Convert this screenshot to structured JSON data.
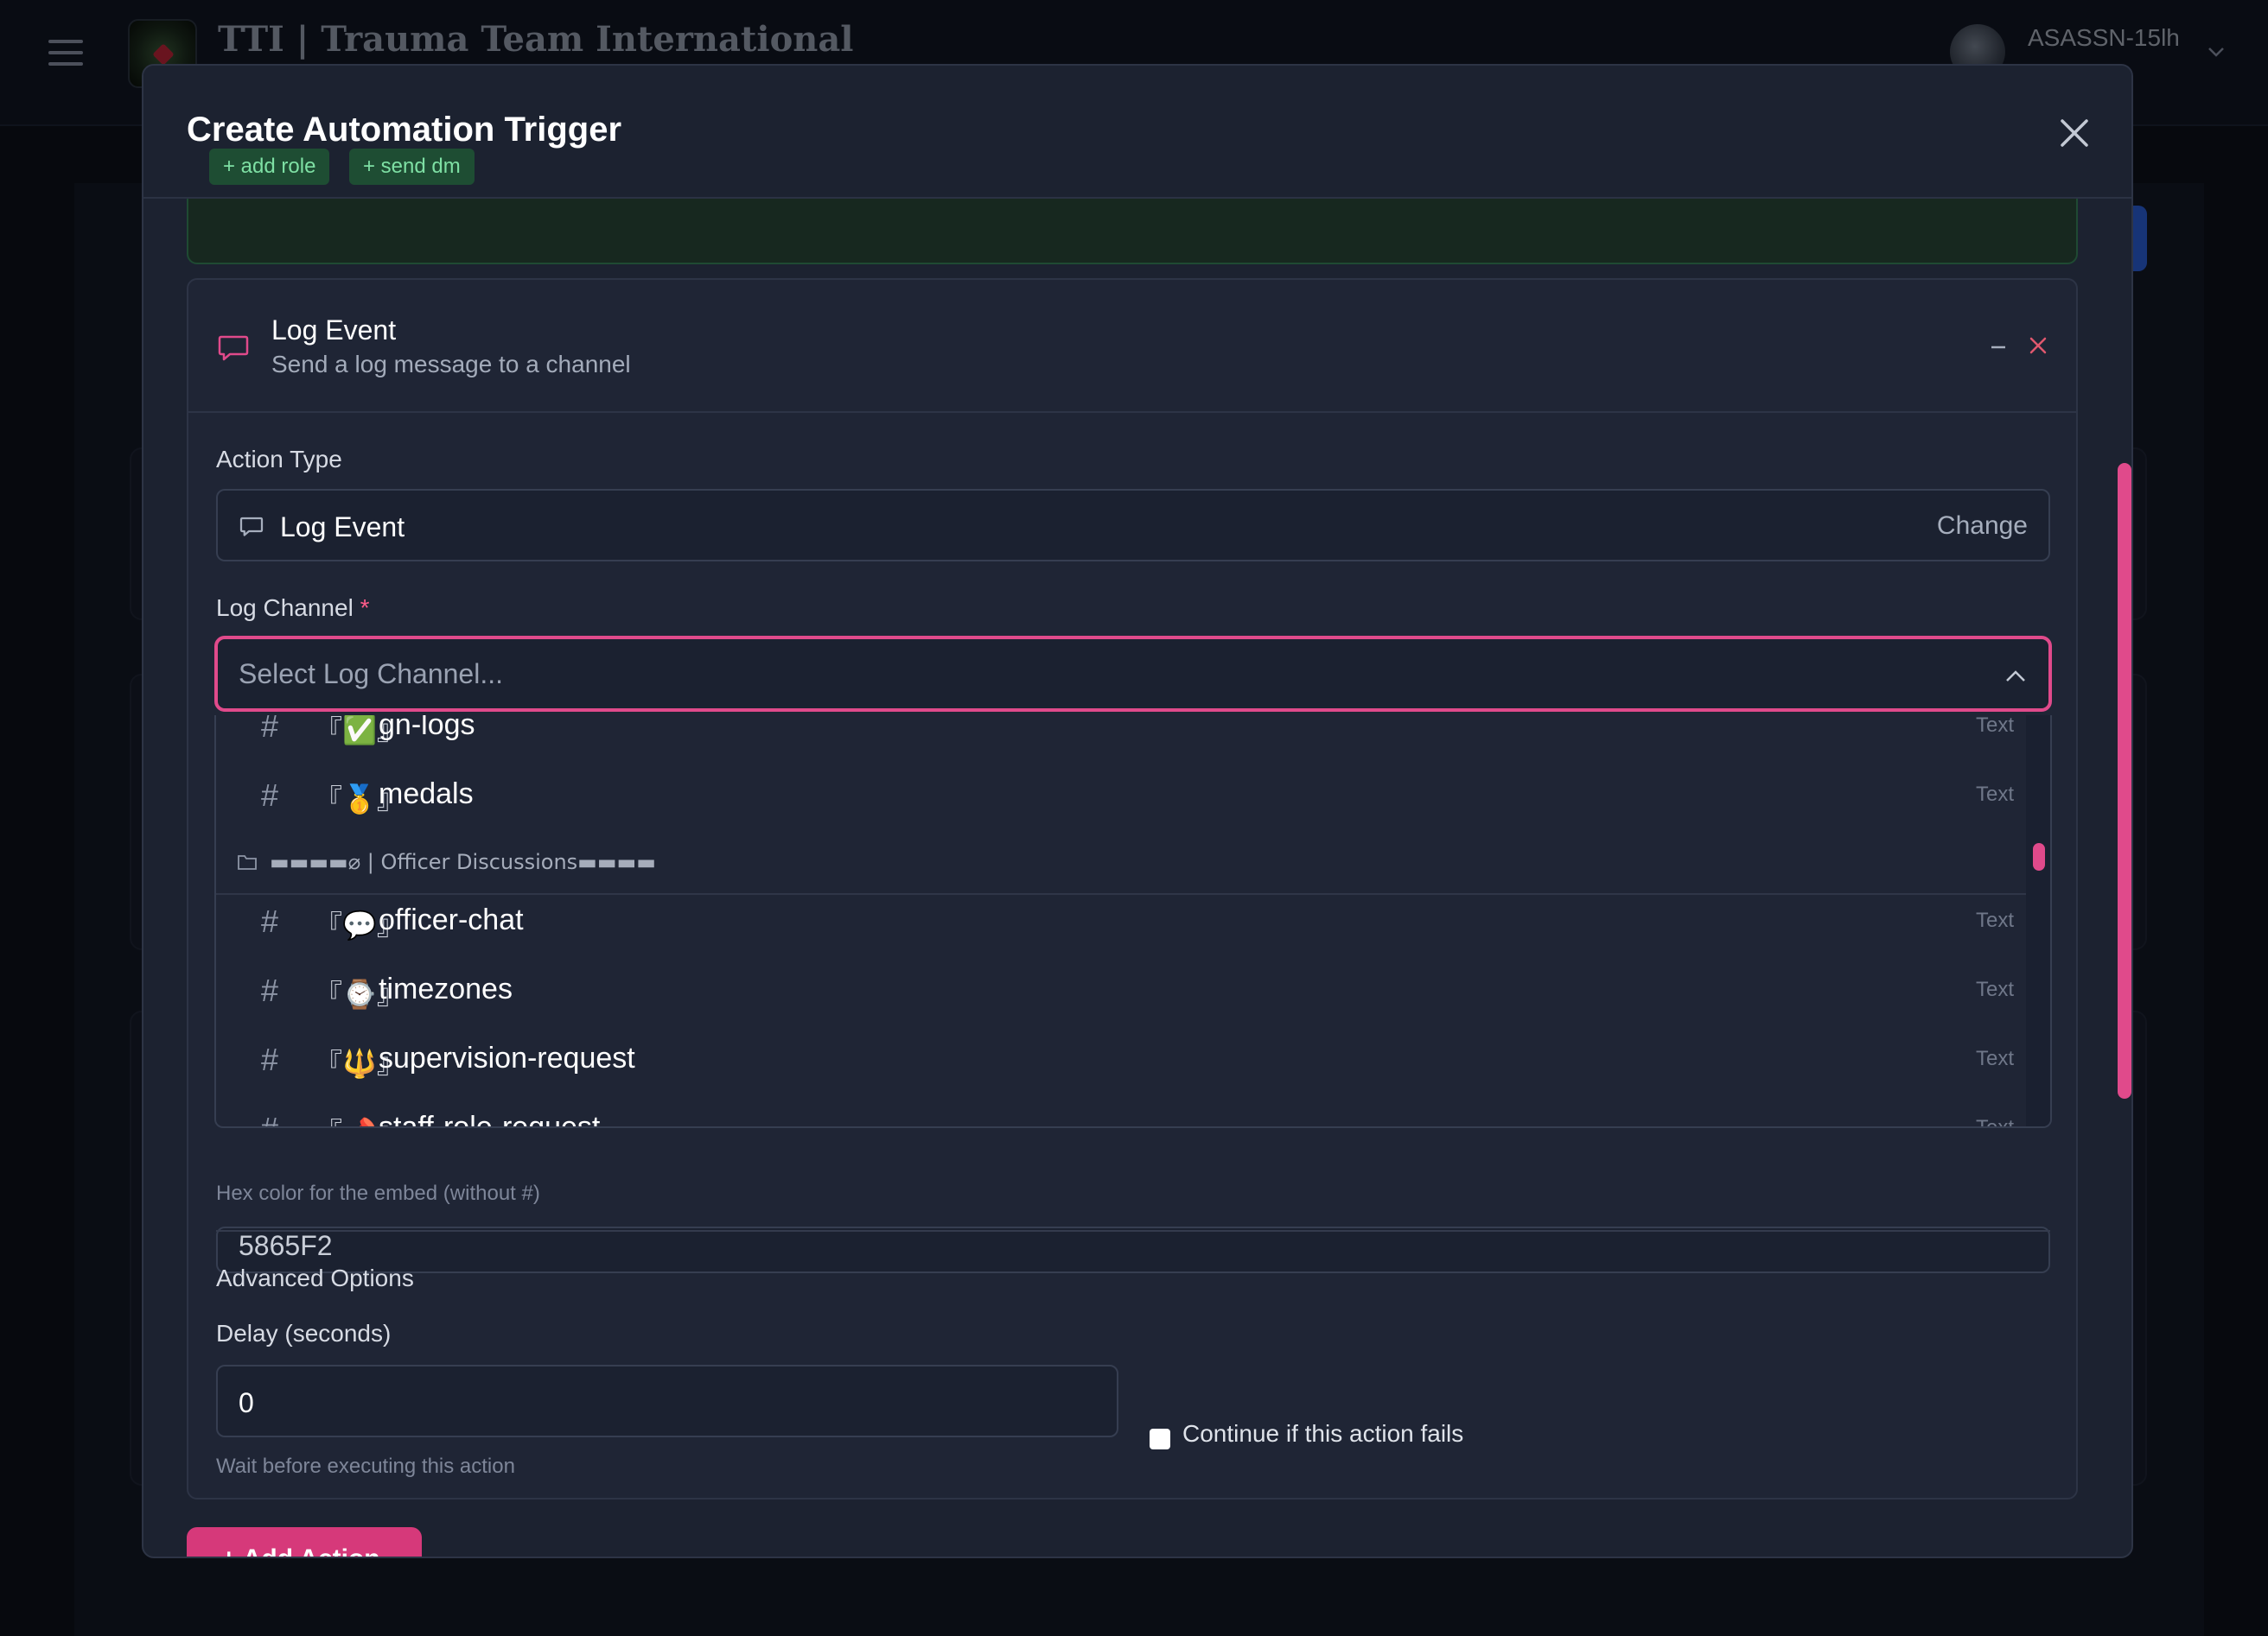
{
  "app": {
    "brand_title": "TTI | Trauma Team International",
    "user_name": "ASASSN-15lh"
  },
  "modal": {
    "title": "Create Automation Trigger",
    "previous_action_chips": [
      "+ add role",
      "+ send dm"
    ],
    "action": {
      "name": "Log Event",
      "description": "Send a log message to a channel",
      "action_type_label": "Action Type",
      "action_type_value": "Log Event",
      "change_label": "Change",
      "log_channel_label": "Log Channel",
      "required_mark": "*",
      "log_channel_placeholder": "Select Log Channel...",
      "color_value": "5865F2",
      "color_hint": "Hex color for the embed (without #)",
      "advanced_title": "Advanced Options",
      "delay_label": "Delay (seconds)",
      "delay_value": "0",
      "delay_hint": "Wait before executing this action",
      "continue_label": "Continue if this action fails"
    },
    "add_action_label": "+ Add Action"
  },
  "dropdown": {
    "channels_top": [
      {
        "emoji": "『✅』",
        "name": "gn-logs",
        "kind": "Text"
      },
      {
        "emoji": "『🥇』",
        "name": "medals",
        "kind": "Text"
      }
    ],
    "category": "▬▬▬▬⌀ | Officer Discussions▬▬▬▬",
    "channels_bottom": [
      {
        "emoji": "『💬』",
        "name": "officer-chat",
        "kind": "Text"
      },
      {
        "emoji": "『⌚』",
        "name": "timezones",
        "kind": "Text"
      },
      {
        "emoji": "『🔱』",
        "name": "supervision-request",
        "kind": "Text"
      },
      {
        "emoji": "『📌』",
        "name": "staff-role-request",
        "kind": "Text"
      }
    ]
  },
  "colors": {
    "accent": "#e04a8b",
    "success": "#7ee0a4",
    "modal_bg": "#1c2230"
  }
}
